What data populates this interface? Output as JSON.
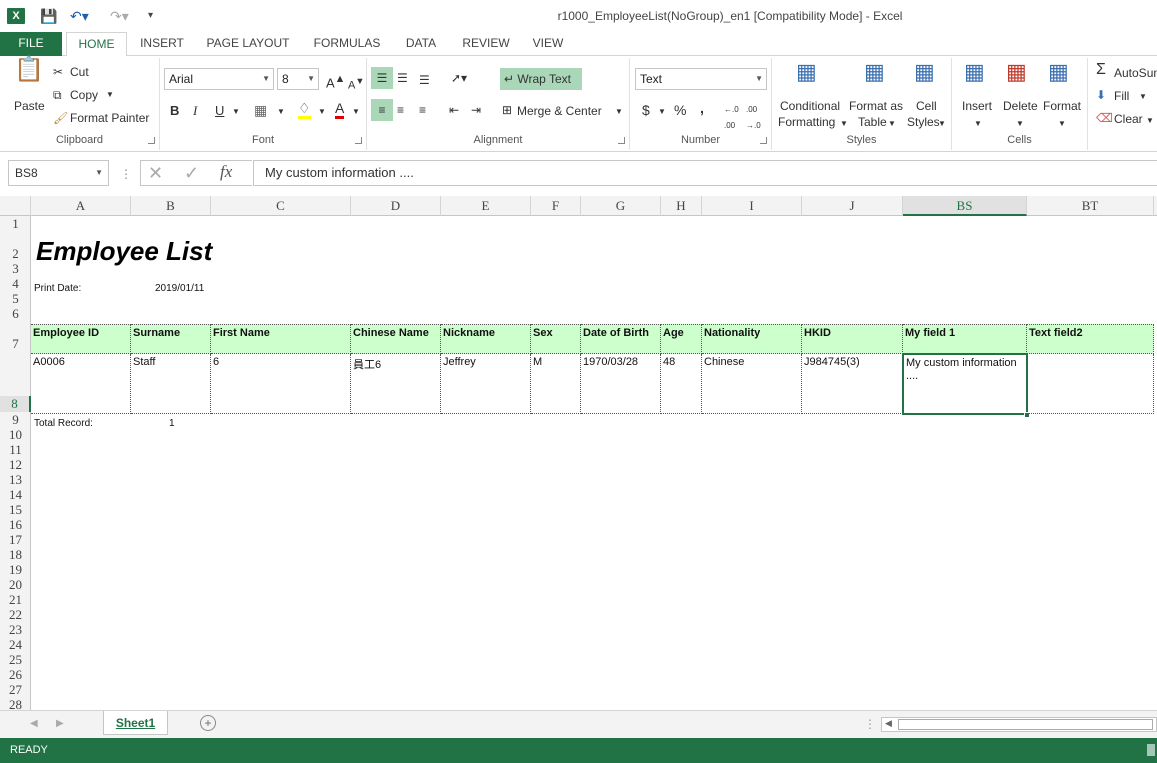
{
  "window": {
    "title": "r1000_EmployeeList(NoGroup)_en1  [Compatibility Mode] - Excel"
  },
  "tabs": [
    "FILE",
    "HOME",
    "INSERT",
    "PAGE LAYOUT",
    "FORMULAS",
    "DATA",
    "REVIEW",
    "VIEW"
  ],
  "ribbon": {
    "clipboard": {
      "paste": "Paste",
      "cut": "Cut",
      "copy": "Copy",
      "format_painter": "Format Painter",
      "label": "Clipboard"
    },
    "font": {
      "name": "Arial",
      "size": "8",
      "bold": "B",
      "italic": "I",
      "underline": "U",
      "label": "Font"
    },
    "alignment": {
      "wrap_text": "Wrap Text",
      "merge_center": "Merge & Center",
      "label": "Alignment"
    },
    "number": {
      "format": "Text",
      "currency": "$",
      "percent": "%",
      "comma": ",",
      "label": "Number"
    },
    "styles": {
      "conditional": "Conditional",
      "conditional2": "Formatting",
      "format_as": "Format as",
      "format_as2": "Table",
      "cell": "Cell",
      "cell2": "Styles",
      "label": "Styles"
    },
    "cells": {
      "insert": "Insert",
      "delete": "Delete",
      "format": "Format",
      "label": "Cells"
    },
    "editing": {
      "autosum": "AutoSum",
      "fill": "Fill",
      "clear": "Clear"
    }
  },
  "formula_bar": {
    "name_box": "BS8",
    "fx": "fx",
    "value": "My custom information ...."
  },
  "columns": [
    "A",
    "B",
    "C",
    "D",
    "E",
    "F",
    "G",
    "H",
    "I",
    "J",
    "BS",
    "BT"
  ],
  "rows": [
    "1",
    "2",
    "3",
    "4",
    "5",
    "6",
    "7",
    "8",
    "9",
    "10",
    "11",
    "12",
    "13",
    "14",
    "15",
    "16",
    "17",
    "18",
    "19",
    "20",
    "21",
    "22",
    "23",
    "24",
    "25",
    "26",
    "27",
    "28"
  ],
  "sheet": {
    "title": "Employee List",
    "print_date_label": "Print Date:",
    "print_date": "2019/01/11",
    "headers": [
      "Employee ID",
      "Surname",
      "First Name",
      "Chinese Name",
      "Nickname",
      "Sex",
      "Date of Birth",
      "Age",
      "Nationality",
      "HKID",
      "My field 1",
      "Text field2"
    ],
    "row": [
      "A0006",
      "Staff",
      "6",
      "員工6",
      "Jeffrey",
      "M",
      "1970/03/28",
      "48",
      "Chinese",
      "J984745(3)",
      "My custom information",
      "...."
    ],
    "total_label": "Total Record:",
    "total_value": "1"
  },
  "sheet_tabs": [
    "Sheet1"
  ],
  "status": "READY",
  "colors": {
    "accent": "#217346",
    "header_fill": "#ccffcc"
  }
}
